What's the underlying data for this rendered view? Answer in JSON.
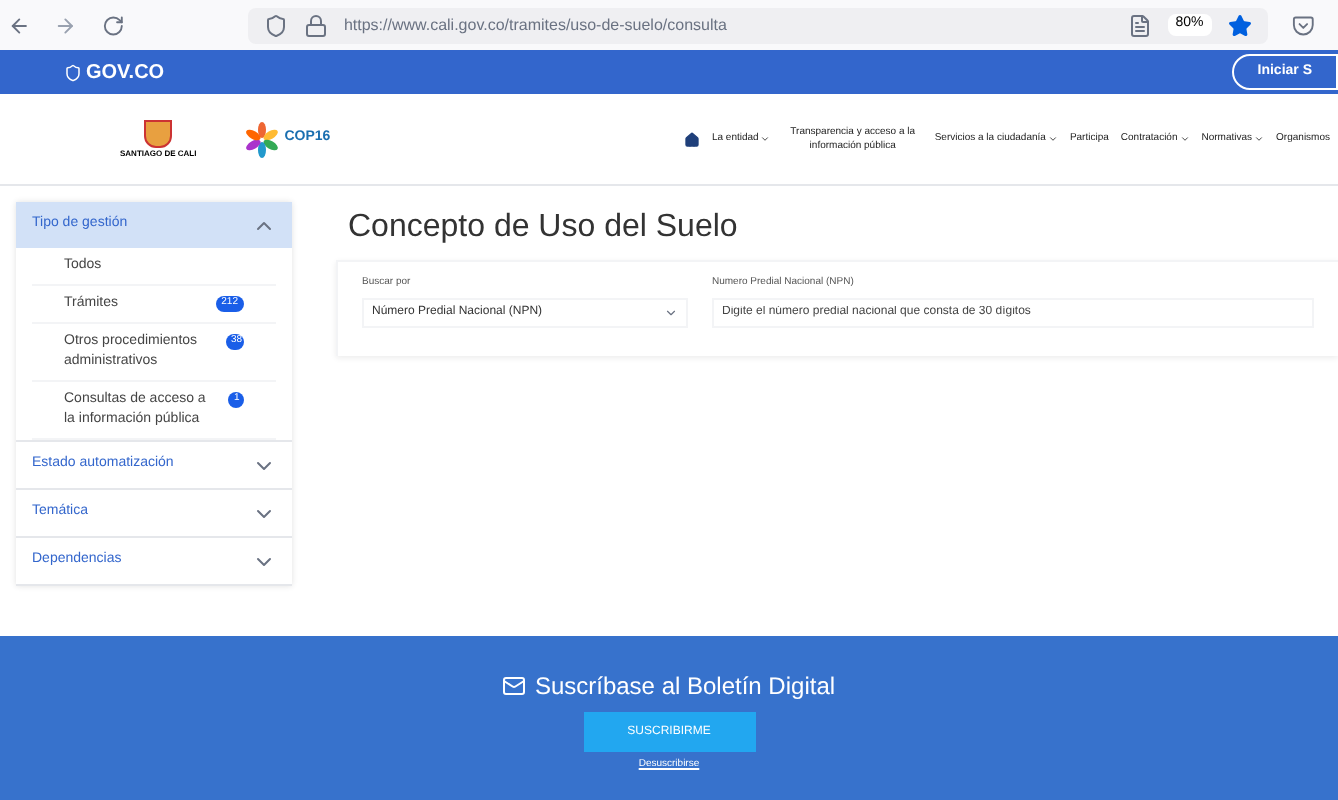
{
  "browser": {
    "url": "https://www.cali.gov.co/tramites/uso-de-suelo/consulta",
    "zoom": "80%"
  },
  "gov_bar": {
    "brand": "GOV.CO",
    "login": "Iniciar S"
  },
  "header": {
    "city_logo": "SANTIAGO DE CALI",
    "event_logo": "COP16",
    "nav": [
      {
        "label": "La entidad",
        "dropdown": true
      },
      {
        "label": "Transparencia y acceso a la información pública",
        "dropdown": false
      },
      {
        "label": "Servicios a la ciudadanía",
        "dropdown": true
      },
      {
        "label": "Participa",
        "dropdown": false
      },
      {
        "label": "Contratación",
        "dropdown": true
      },
      {
        "label": "Normativas",
        "dropdown": true
      },
      {
        "label": "Organismos",
        "dropdown": false
      }
    ]
  },
  "sidebar": {
    "sections": [
      {
        "title": "Tipo de gestión",
        "expanded": true,
        "items": [
          {
            "label": "Todos"
          },
          {
            "label": "Trámites",
            "count": "212"
          },
          {
            "label": "Otros procedimientos administrativos",
            "count": "38"
          },
          {
            "label": "Consultas de acceso a la información pública",
            "count": "1"
          }
        ]
      },
      {
        "title": "Estado automatización",
        "expanded": false
      },
      {
        "title": "Temática",
        "expanded": false
      },
      {
        "title": "Dependencias",
        "expanded": false
      }
    ]
  },
  "main": {
    "title": "Concepto de Uso del Suelo",
    "search_by": {
      "label": "Buscar por",
      "value": "Número Predial Nacional (NPN)"
    },
    "npn": {
      "label": "Numero Predial Nacional (NPN)",
      "placeholder": "Digite el número predial nacional que consta de 30 dígitos"
    }
  },
  "footer": {
    "title": "Suscríbase al Boletín Digital",
    "button": "SUSCRIBIRME",
    "link": "Desuscribirse"
  }
}
